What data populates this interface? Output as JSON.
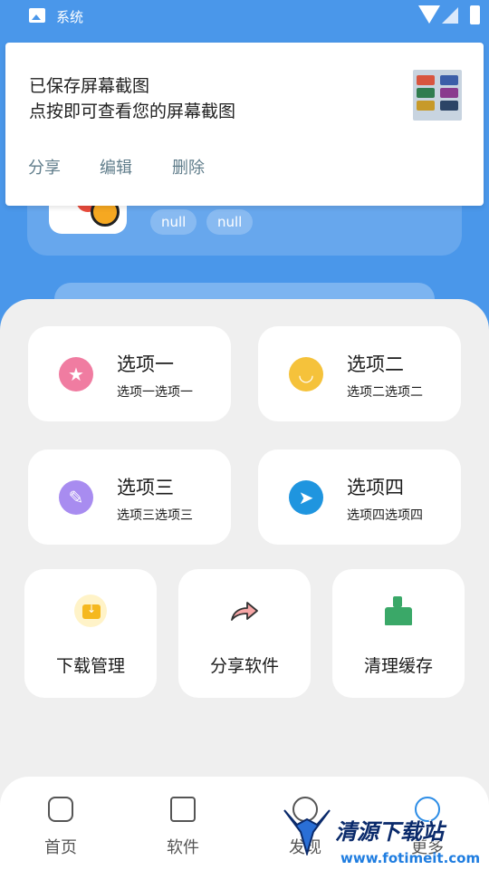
{
  "status_bar": {
    "app_label": "系统"
  },
  "notification": {
    "title": "已保存屏幕截图",
    "subtitle": "点按即可查看您的屏幕截图",
    "actions": [
      "分享",
      "编辑",
      "删除"
    ]
  },
  "profile": {
    "chips": [
      "null",
      "null"
    ]
  },
  "options": [
    {
      "title": "选项一",
      "subtitle": "选项一选项一",
      "icon": "star-icon",
      "color": "#f07ca1"
    },
    {
      "title": "选项二",
      "subtitle": "选项二选项二",
      "icon": "chat-bubble-icon",
      "color": "#f5c23b"
    },
    {
      "title": "选项三",
      "subtitle": "选项三选项三",
      "icon": "note-edit-icon",
      "color": "#a88cf0"
    },
    {
      "title": "选项四",
      "subtitle": "选项四选项四",
      "icon": "send-plane-icon",
      "color": "#1f95df"
    }
  ],
  "tools": [
    {
      "label": "下载管理",
      "icon": "download-folder-icon"
    },
    {
      "label": "分享软件",
      "icon": "share-arrow-icon"
    },
    {
      "label": "清理缓存",
      "icon": "broom-icon"
    }
  ],
  "bottom_nav": [
    {
      "label": "首页",
      "icon": "home-icon"
    },
    {
      "label": "软件",
      "icon": "cube-icon"
    },
    {
      "label": "发现",
      "icon": "compass-icon"
    },
    {
      "label": "更多",
      "icon": "circle-icon"
    }
  ],
  "watermark": {
    "name": "清源下载站",
    "url": "www.fotimeit.com"
  },
  "colors": {
    "header_blue": "#4a97ea",
    "active_nav": "#2d8de6"
  }
}
